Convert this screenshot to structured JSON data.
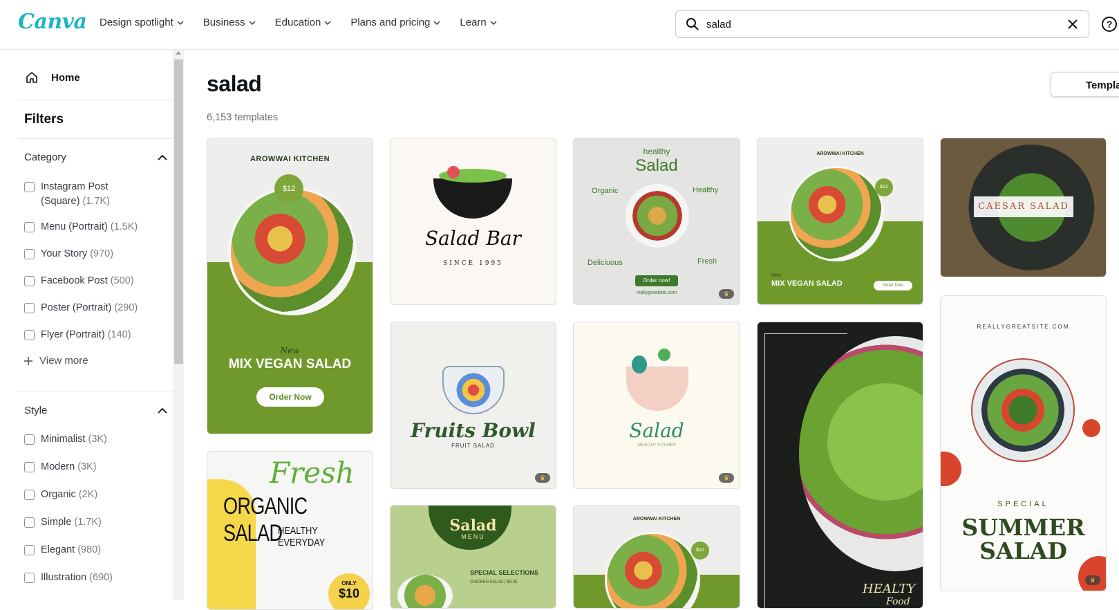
{
  "header": {
    "logo": "Canva",
    "nav": [
      {
        "label": "Design spotlight"
      },
      {
        "label": "Business"
      },
      {
        "label": "Education"
      },
      {
        "label": "Plans and pricing"
      },
      {
        "label": "Learn"
      }
    ],
    "search_value": "salad",
    "help_label": "?"
  },
  "sidebar": {
    "home_label": "Home",
    "filters_title": "Filters",
    "category": {
      "title": "Category",
      "options": [
        {
          "label": "Instagram Post (Square)",
          "count": "(1.7K)"
        },
        {
          "label": "Menu (Portrait)",
          "count": "(1.5K)"
        },
        {
          "label": "Your Story",
          "count": "(970)"
        },
        {
          "label": "Facebook Post",
          "count": "(500)"
        },
        {
          "label": "Poster (Portrait)",
          "count": "(290)"
        },
        {
          "label": "Flyer (Portrait)",
          "count": "(140)"
        }
      ],
      "view_more": "View more"
    },
    "style": {
      "title": "Style",
      "options": [
        {
          "label": "Minimalist",
          "count": "(3K)"
        },
        {
          "label": "Modern",
          "count": "(3K)"
        },
        {
          "label": "Organic",
          "count": "(2K)"
        },
        {
          "label": "Simple",
          "count": "(1.7K)"
        },
        {
          "label": "Elegant",
          "count": "(980)"
        },
        {
          "label": "Illustration",
          "count": "(690)"
        }
      ]
    }
  },
  "main": {
    "title": "salad",
    "count": "6,153 templates",
    "templates_button": "Templa"
  },
  "templates": {
    "t1": {
      "brand": "AROWWAI KITCHEN",
      "price": "$12",
      "new": "New",
      "title": "MIX VEGAN SALAD",
      "cta": "Order Now"
    },
    "t2": {
      "title": "Salad Bar",
      "sub": "SINCE 1995"
    },
    "t3": {
      "top": "healthy",
      "title": "Salad",
      "l1": "Organic",
      "l2": "Healthy",
      "l3": "Deliciuous",
      "l4": "Fresh",
      "cta": "Order now!",
      "url": "reallygreatsite.com"
    },
    "t4": {
      "brand": "AROWWAI KITCHEN",
      "price": "$12",
      "new": "New",
      "title": "MIX VEGAN SALAD",
      "cta": "Order Now"
    },
    "t5": {
      "title": "CAESAR SALAD"
    },
    "t6": {
      "title": "Fruits Bowl",
      "sub": "FRUIT SALAD"
    },
    "t7": {
      "title": "Salad",
      "sub": "HEALTHY KITCHEN"
    },
    "t8": {
      "script": "Fresh",
      "title": "ORGANIC SALAD",
      "sub": "HEALTHY EVERYDAY",
      "only": "ONLY",
      "price": "$10"
    },
    "t9": {
      "title": "Salad",
      "sub": "MENU",
      "sel": "SPECIAL SELECTIONS",
      "item": "CHICKEN SALAD  |  $9.25"
    },
    "t10": {
      "brand": "AROWWAI KITCHEN",
      "price": "$12"
    },
    "t11": {
      "title": "HEALTY",
      "sub": "Food"
    },
    "t12": {
      "url": "REALLYGREATSITE.COM",
      "special": "SPECIAL",
      "title1": "SUMMER",
      "title2": "SALAD"
    }
  },
  "colors": {
    "accent_green": "#6f9a2b",
    "canva_teal": "#1fb3c7",
    "dark_green": "#2f5a2b"
  }
}
